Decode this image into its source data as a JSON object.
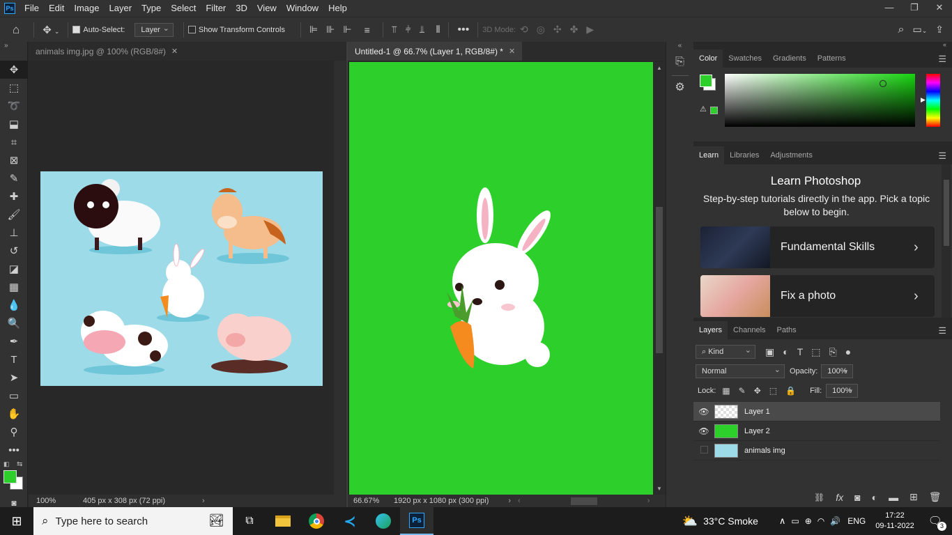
{
  "app": {
    "logo": "Ps"
  },
  "menu": [
    "File",
    "Edit",
    "Image",
    "Layer",
    "Type",
    "Select",
    "Filter",
    "3D",
    "View",
    "Window",
    "Help"
  ],
  "window_controls": [
    "—",
    "❐",
    "✕"
  ],
  "options_bar": {
    "auto_select_label": "Auto-Select:",
    "auto_select_target": "Layer",
    "show_transform_label": "Show Transform Controls",
    "mode_3d_label": "3D Mode:"
  },
  "doc1": {
    "tab_title": "animals img.jpg @ 100% (RGB/8#)",
    "zoom": "100%",
    "info": "405 px x 308 px (72 ppi)"
  },
  "doc2": {
    "tab_title": "Untitled-1 @ 66.7% (Layer 1, RGB/8#) *",
    "zoom": "66.67%",
    "info": "1920 px x 1080 px (300 ppi)",
    "canvas_color": "#2dcf2a"
  },
  "color_panel": {
    "tabs": [
      "Color",
      "Swatches",
      "Gradients",
      "Patterns"
    ],
    "foreground": "#2dcf2a",
    "background": "#ffffff"
  },
  "learn_panel": {
    "tabs": [
      "Learn",
      "Libraries",
      "Adjustments"
    ],
    "title": "Learn Photoshop",
    "subtitle": "Step-by-step tutorials directly in the app. Pick a topic below to begin.",
    "cards": [
      {
        "title": "Fundamental Skills"
      },
      {
        "title": "Fix a photo"
      }
    ]
  },
  "layers_panel": {
    "tabs": [
      "Layers",
      "Channels",
      "Paths"
    ],
    "filter_kind": "Kind",
    "blend_mode": "Normal",
    "opacity_label": "Opacity:",
    "opacity_value": "100%",
    "lock_label": "Lock:",
    "fill_label": "Fill:",
    "fill_value": "100%",
    "layers": [
      {
        "name": "Layer 1",
        "visible": true,
        "selected": true
      },
      {
        "name": "Layer 2",
        "visible": true,
        "selected": false
      },
      {
        "name": "animals img",
        "visible": false,
        "selected": false
      }
    ]
  },
  "taskbar": {
    "search_placeholder": "Type here to search",
    "weather": "33°C  Smoke",
    "language": "ENG",
    "time": "17:22",
    "date": "09-11-2022",
    "notification_count": "3"
  }
}
